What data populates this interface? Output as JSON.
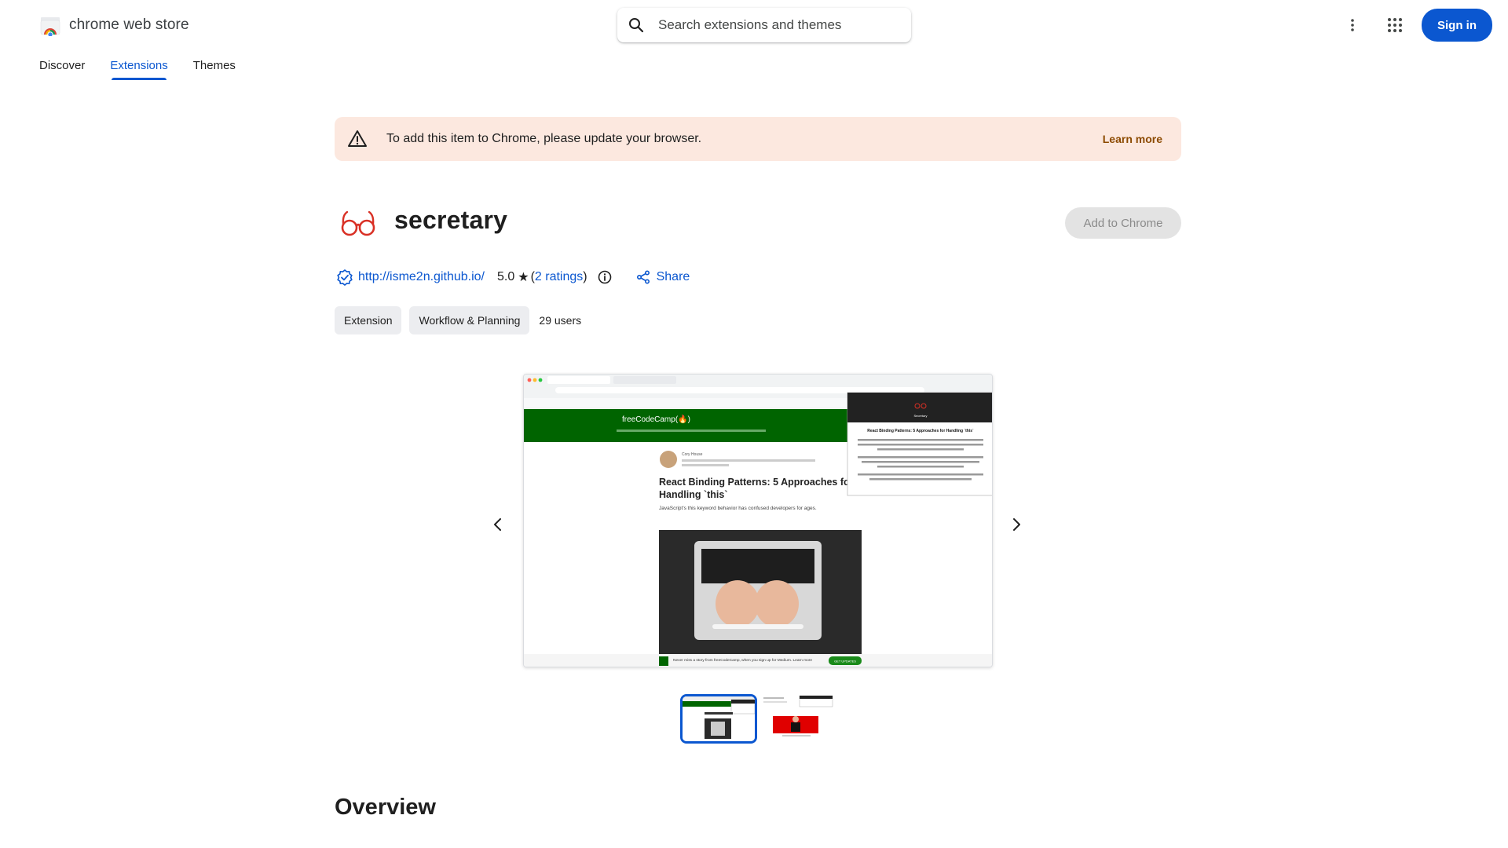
{
  "header": {
    "brand_name": "chrome web store",
    "search_placeholder": "Search extensions and themes",
    "sign_in_label": "Sign in",
    "icons": [
      "chrome-web-store-logo",
      "search-icon",
      "more-vert-icon",
      "apps-grid-icon"
    ]
  },
  "nav": {
    "tabs": [
      {
        "label": "Discover",
        "active": false
      },
      {
        "label": "Extensions",
        "active": true
      },
      {
        "label": "Themes",
        "active": false
      }
    ]
  },
  "banner": {
    "message": "To add this item to Chrome, please update your browser.",
    "link_label": "Learn more",
    "icon": "warning-icon"
  },
  "extension": {
    "title": "secretary",
    "add_button_label": "Add to Chrome",
    "add_button_enabled": false,
    "website": "http://isme2n.github.io/",
    "rating_value": "5.0",
    "ratings_count_label": "2 ratings",
    "share_label": "Share",
    "chips": [
      "Extension",
      "Workflow & Planning"
    ],
    "users": "29 users"
  },
  "screenshot": {
    "site_name": "freeCodeCamp(🔥)",
    "article_title_1": "React Binding Patterns: 5 Approaches for",
    "article_title_2": "Handling `this`",
    "article_subtitle": "JavaScript's this keyword behavior has confused developers for ages.",
    "author": "Cory House",
    "popup_title": "React Binding Patterns: 5 Approaches for Handling `this`",
    "popup_brand": "Secretary",
    "footer_text": "Never miss a story from freeCodeCamp, when you sign up for Medium. Learn more",
    "footer_button": "GET UPDATES",
    "active_index": 0,
    "count": 2
  },
  "section": {
    "overview_heading": "Overview"
  },
  "colors": {
    "primary": "#0b57d0",
    "banner_bg": "#fce8df",
    "banner_link": "#8c4a00",
    "logo_red": "#d93025",
    "fcc_green": "#006400"
  }
}
